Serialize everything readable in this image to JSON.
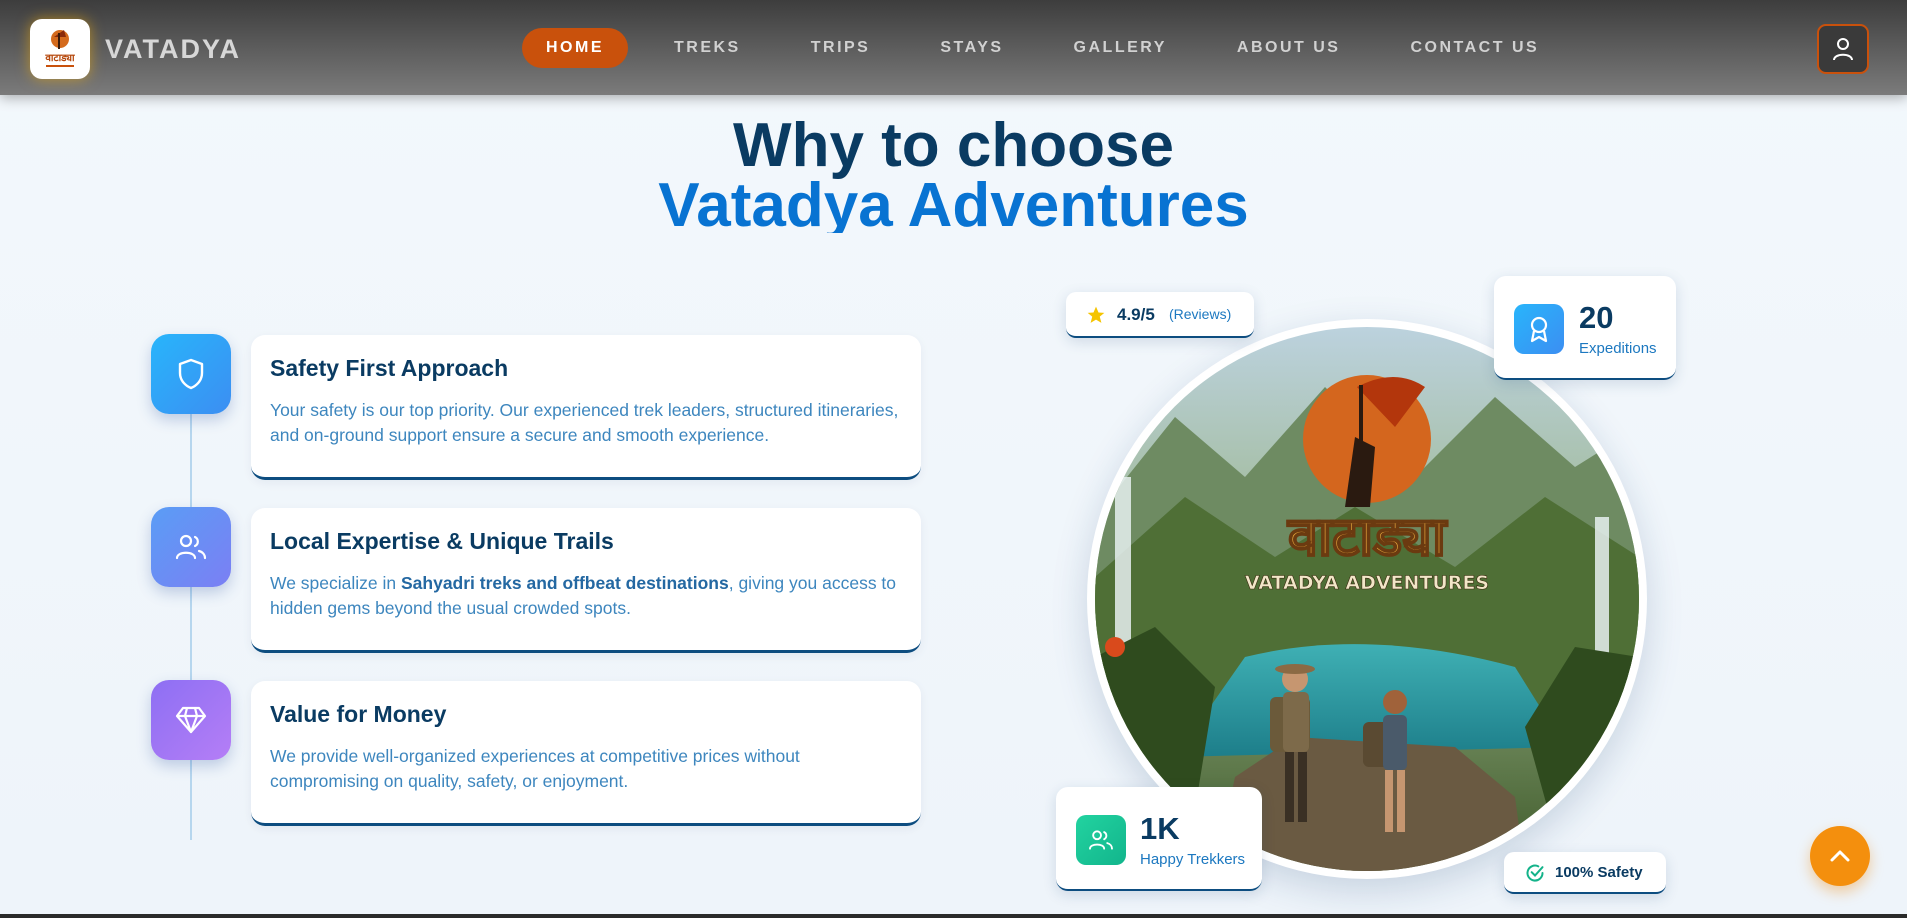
{
  "header": {
    "brand": "VATADYA",
    "logo_icon": "vatadya-logo-icon",
    "nav": [
      {
        "label": "HOME",
        "active": true
      },
      {
        "label": "TREKS",
        "active": false
      },
      {
        "label": "TRIPS",
        "active": false
      },
      {
        "label": "STAYS",
        "active": false
      },
      {
        "label": "GALLERY",
        "active": false
      },
      {
        "label": "ABOUT US",
        "active": false
      },
      {
        "label": "CONTACT US",
        "active": false
      }
    ],
    "user_icon": "user-icon",
    "accent": "#c9510c"
  },
  "hero": {
    "title_line1": "Why to choose",
    "title_line2": "Vatadya Adventures",
    "title_color1": "#0a3b62",
    "title_color2": "#0873d2"
  },
  "features": [
    {
      "icon": "shield-icon",
      "title": "Safety First Approach",
      "desc": "Your safety is our top priority. Our experienced trek leaders, structured itineraries, and on-ground support ensure a secure and smooth experience.",
      "color_from": "#28b5fb",
      "color_to": "#3c8ef2"
    },
    {
      "icon": "users-icon",
      "title": "Local Expertise & Unique Trails",
      "desc_before": "We specialize in ",
      "desc_bold": "Sahyadri treks and offbeat destinations",
      "desc_after": ", giving you access to hidden gems beyond the usual crowded spots.",
      "color_from": "#5a9df5",
      "color_to": "#7b7ff4"
    },
    {
      "icon": "diamond-icon",
      "title": "Value for Money",
      "desc": "We provide well-organized experiences at competitive prices without compromising on quality, safety, or enjoyment.",
      "color_from": "#8d6ff3",
      "color_to": "#b57ef6"
    }
  ],
  "stats": {
    "rating": {
      "icon": "star-icon",
      "value": "4.9/5",
      "label": "(Reviews)"
    },
    "expeditions": {
      "icon": "award-icon",
      "value": "20",
      "label": "Expeditions"
    },
    "trekkers": {
      "icon": "users-icon",
      "value": "1K",
      "label": "Happy Trekkers"
    },
    "safety": {
      "icon": "check-circle-icon",
      "label": "100% Safety"
    }
  },
  "image": {
    "logo_text_devanagari": "वाटाड्या",
    "logo_text_english": "VATADYA ADVENTURES"
  },
  "scroll_top_icon": "chevron-up-icon"
}
